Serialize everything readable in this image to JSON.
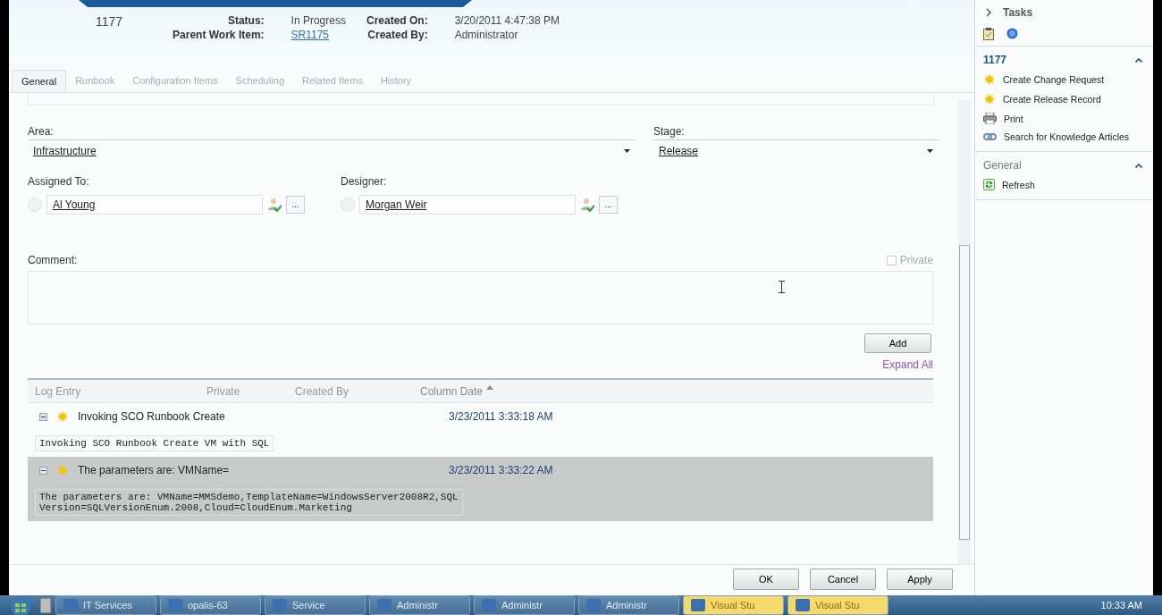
{
  "header": {
    "id": "1177",
    "fields": [
      {
        "label": "Status:",
        "value": "In Progress",
        "link": false
      },
      {
        "label": "Parent Work Item:",
        "value": "SR1175",
        "link": true
      }
    ],
    "fields_right": [
      {
        "label": "Created On:",
        "value": "3/20/2011 4:47:38 PM"
      },
      {
        "label": "Created By:",
        "value": "Administrator"
      }
    ]
  },
  "tabs": [
    {
      "label": "General",
      "selected": true
    },
    {
      "label": "Runbook",
      "selected": false
    },
    {
      "label": "Configuration Items",
      "selected": false
    },
    {
      "label": "Scheduling",
      "selected": false
    },
    {
      "label": "Related Items",
      "selected": false
    },
    {
      "label": "History",
      "selected": false
    }
  ],
  "area": {
    "label": "Area:",
    "value": "Infrastructure"
  },
  "stage": {
    "label": "Stage:",
    "value": "Release"
  },
  "assigned_to": {
    "label": "Assigned To:",
    "value": "Al Young",
    "browse": "..."
  },
  "designer": {
    "label": "Designer:",
    "value": "Morgan Weir",
    "browse": "..."
  },
  "comment": {
    "label": "Comment:",
    "private_label": "Private",
    "private_checked": false
  },
  "add_button": "Add",
  "expand_all": "Expand All",
  "log": {
    "columns": [
      {
        "label": "Log Entry",
        "sorted": false
      },
      {
        "label": "Private",
        "sorted": false
      },
      {
        "label": "Created By",
        "sorted": false
      },
      {
        "label": "Column Date",
        "sorted": true
      }
    ],
    "rows": [
      {
        "title": "Invoking SCO Runbook Create",
        "date": "3/23/2011 3:33:18 AM",
        "detail": "Invoking SCO Runbook Create VM with SQL",
        "expanded": true,
        "selected": false
      },
      {
        "title": "The parameters are: VMName=",
        "date": "3/23/2011 3:33:22 AM",
        "detail": "The parameters are: VMName=MMSdemo,TemplateName=WindowsServer2008R2,SQL\nVersion=SQLVersionEnum.2008,Cloud=CloudEnum.Marketing",
        "expanded": true,
        "selected": true
      }
    ]
  },
  "buttons": [
    "OK",
    "Cancel",
    "Apply"
  ],
  "tasks": {
    "title": "Tasks",
    "sections": [
      {
        "title": "1177",
        "kind": "item",
        "items": [
          {
            "label": "Create Change Request",
            "kind": "star"
          },
          {
            "label": "Create Release Record",
            "kind": "star"
          },
          {
            "label": "Print",
            "kind": "print"
          },
          {
            "label": "Search for Knowledge Articles",
            "kind": "link"
          }
        ]
      },
      {
        "title": "General",
        "kind": "plain",
        "items": [
          {
            "label": "Refresh",
            "kind": "refresh"
          }
        ]
      }
    ]
  },
  "taskbar": {
    "items": [
      {
        "label": "IT Services",
        "active": false
      },
      {
        "label": "opalis-63",
        "active": false
      },
      {
        "label": "Service",
        "active": false
      },
      {
        "label": "Administr",
        "active": false
      },
      {
        "label": "Administr",
        "active": false
      },
      {
        "label": "Administr",
        "active": false
      },
      {
        "label": "Visual Stu",
        "active": true
      },
      {
        "label": "Visual Stu",
        "active": true
      }
    ],
    "clock": "10:33 AM"
  }
}
